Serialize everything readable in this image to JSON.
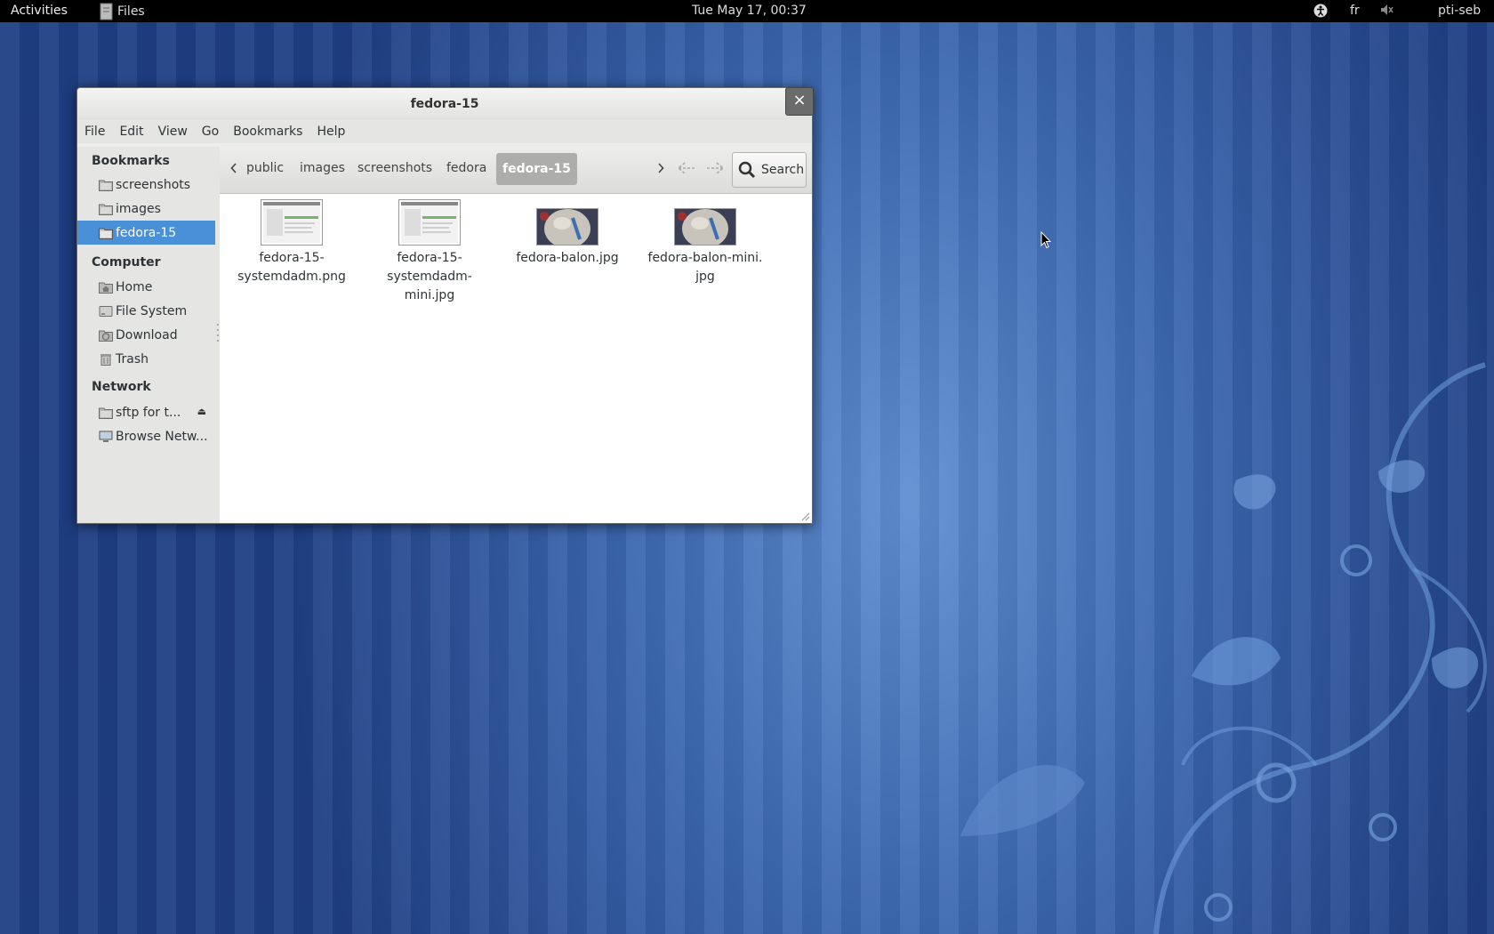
{
  "topbar": {
    "activities": "Activities",
    "app_menu": "Files",
    "clock": "Tue May 17, 00:37",
    "language": "fr",
    "user": "pti-seb"
  },
  "window": {
    "title": "fedora-15",
    "close_label": "×",
    "menu": [
      "File",
      "Edit",
      "View",
      "Go",
      "Bookmarks",
      "Help"
    ]
  },
  "sidebar": {
    "bookmarks_header": "Bookmarks",
    "bookmarks": [
      {
        "label": "screenshots",
        "icon": "folder-icon"
      },
      {
        "label": "images",
        "icon": "folder-icon"
      },
      {
        "label": "fedora-15",
        "icon": "folder-icon",
        "selected": true
      }
    ],
    "computer_header": "Computer",
    "computer": [
      {
        "label": "Home",
        "icon": "home-folder-icon"
      },
      {
        "label": "File System",
        "icon": "harddisk-icon"
      },
      {
        "label": "Download",
        "icon": "download-folder-icon"
      },
      {
        "label": "Trash",
        "icon": "trash-icon"
      }
    ],
    "network_header": "Network",
    "network": [
      {
        "label": "sftp for t...",
        "icon": "network-folder-icon",
        "eject": "⏏"
      },
      {
        "label": "Browse Netw...",
        "icon": "network-computer-icon"
      }
    ]
  },
  "pathbar": {
    "crumbs": [
      "public",
      "images",
      "screenshots",
      "fedora",
      "fedora-15"
    ],
    "current": "fedora-15",
    "search_label": "Search"
  },
  "files": [
    {
      "name": "fedora-15-\nsystemdadm.png",
      "thumb": "screenshot"
    },
    {
      "name": "fedora-15-\nsystemdadm-mini.jpg",
      "thumb": "screenshot"
    },
    {
      "name": "fedora-balon.jpg",
      "thumb": "photo"
    },
    {
      "name": "fedora-balon-mini.\njpg",
      "thumb": "photo"
    }
  ],
  "colors": {
    "selection": "#4a90d9",
    "desktop": "#3c68b0"
  }
}
